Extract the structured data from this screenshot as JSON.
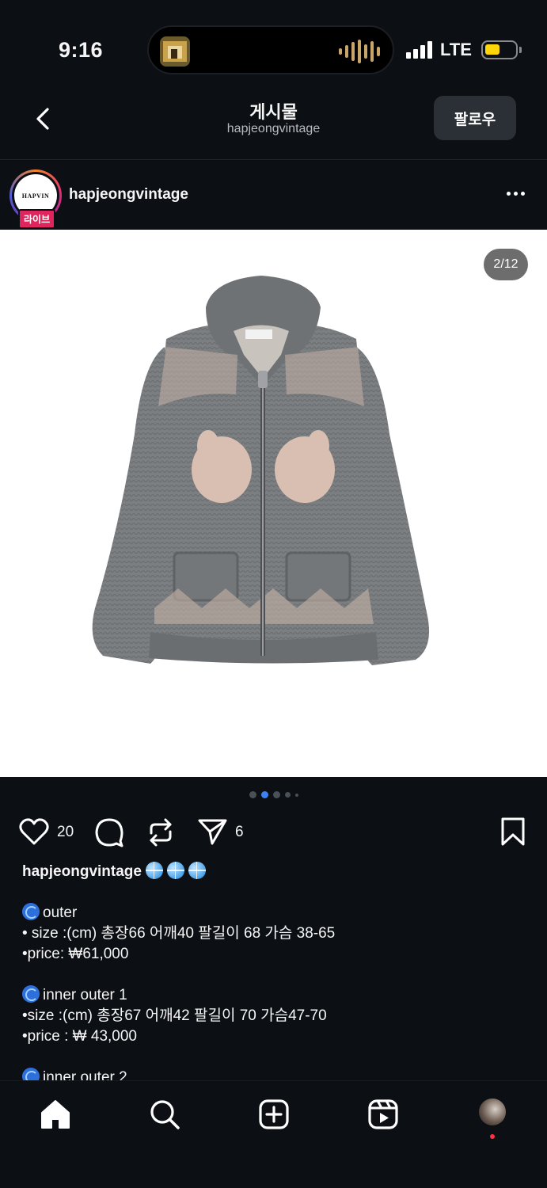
{
  "status_bar": {
    "time": "9:16",
    "network": "LTE",
    "battery_color": "#ffd60a"
  },
  "header": {
    "title": "게시물",
    "subtitle": "hapjeongvintage",
    "follow_label": "팔로우",
    "back_icon": "chevron-left-icon"
  },
  "author": {
    "username": "hapjeongvintage",
    "avatar_text": "HAPVIN",
    "live_badge": "라이브",
    "more_icon": "more-horizontal-icon"
  },
  "media": {
    "counter": "2/12",
    "current_slide": 2,
    "total_slides": 12,
    "dots_active_index": 1,
    "dots_count": 5,
    "accent_color": "#3b82f6"
  },
  "actions": {
    "like_count": "20",
    "share_count": "6",
    "icons": [
      "heart-icon",
      "comment-icon",
      "repost-icon",
      "send-icon",
      "bookmark-icon"
    ]
  },
  "caption": {
    "username": "hapjeongvintage",
    "lines": [
      {
        "emoji": "cyclone",
        "text": "outer"
      },
      {
        "text": "• size :(cm) 총장66 어깨40 팔길이 68 가슴 38-65"
      },
      {
        "text": "•price: ₩61,000"
      },
      {
        "gap": true
      },
      {
        "emoji": "cyclone",
        "text": "inner outer 1"
      },
      {
        "text": "•size :(cm) 총장67 어깨42  팔길이 70 가슴47-70"
      },
      {
        "text": "•price : ₩ 43,000"
      },
      {
        "gap": true
      },
      {
        "emoji": "cyclone",
        "text": "inner outer 2"
      }
    ]
  },
  "tabbar": {
    "icons": [
      "home-icon",
      "search-icon",
      "create-icon",
      "reels-icon",
      "profile-avatar"
    ],
    "notification_color": "#ff3040"
  }
}
